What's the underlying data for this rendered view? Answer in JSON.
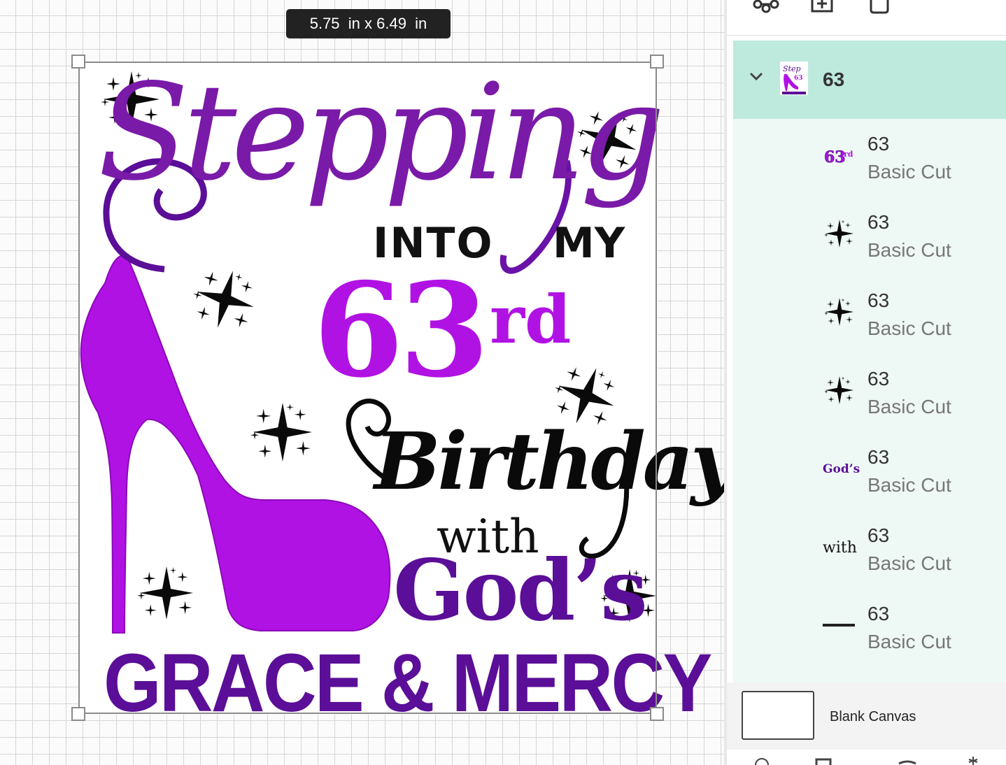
{
  "canvas": {
    "size_readout": "5.75  in x 6.49  in",
    "design_text": {
      "stepping": "Stepping",
      "into": "INTO",
      "my": "MY",
      "number": "63",
      "suffix": "rd",
      "birthday": "Birthday",
      "with": "with",
      "gods": "God’s",
      "grace_mercy": "GRACE & MERCY"
    },
    "colors": {
      "purple_dark": "#5b0e97",
      "purple_mid": "#7a1aa8",
      "magenta": "#b112e4",
      "black": "#0a0a0a"
    }
  },
  "toolbar": {
    "icons": [
      "group-icon",
      "duplicate-icon",
      "delete-icon"
    ]
  },
  "layers_panel": {
    "group": {
      "label": "63",
      "expanded": true
    },
    "layers": [
      {
        "name": "63",
        "type": "Basic Cut",
        "thumb": "63rd"
      },
      {
        "name": "63",
        "type": "Basic Cut",
        "thumb": "sparkle"
      },
      {
        "name": "63",
        "type": "Basic Cut",
        "thumb": "sparkle"
      },
      {
        "name": "63",
        "type": "Basic Cut",
        "thumb": "sparkle"
      },
      {
        "name": "63",
        "type": "Basic Cut",
        "thumb": "God's"
      },
      {
        "name": "63",
        "type": "Basic Cut",
        "thumb": "with"
      },
      {
        "name": "63",
        "type": "Basic Cut",
        "thumb": "GRACE & MERCY"
      }
    ],
    "blank_canvas_label": "Blank Canvas"
  }
}
